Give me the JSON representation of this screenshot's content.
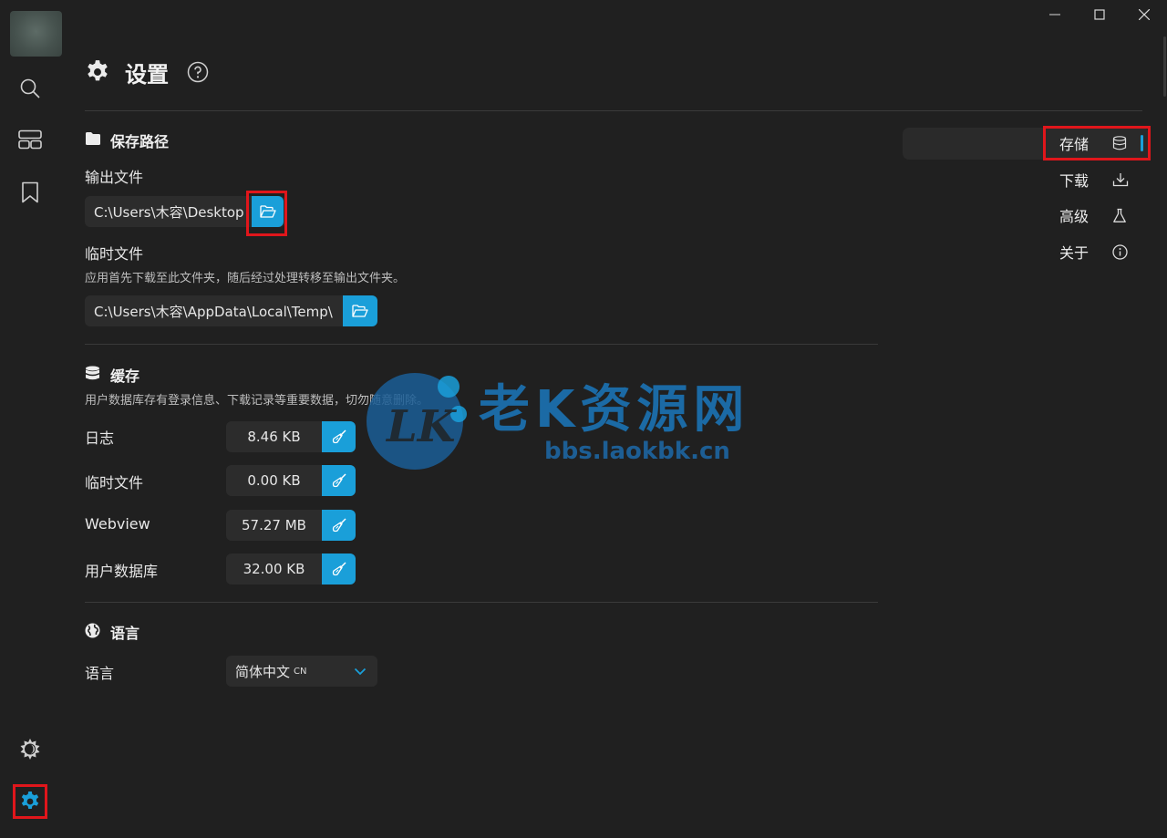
{
  "window": {
    "controls": [
      "minimize",
      "maximize",
      "close"
    ]
  },
  "sidebar": {
    "icons": [
      "search-icon",
      "layout-icon",
      "bookmark-icon",
      "theme-icon",
      "settings-icon"
    ],
    "active": "settings-icon",
    "accent": "#1a9fd9"
  },
  "header": {
    "title": "设置",
    "help_icon": "question-circle-icon"
  },
  "storage": {
    "title": "保存路径",
    "output_label": "输出文件",
    "output_path": "C:\\Users\\木容\\Desktop",
    "temp_label": "临时文件",
    "temp_desc": "应用首先下载至此文件夹，随后经过处理转移至输出文件夹。",
    "temp_path": "C:\\Users\\木容\\AppData\\Local\\Temp\\"
  },
  "cache": {
    "title": "缓存",
    "desc": "用户数据库存有登录信息、下载记录等重要数据，切勿随意删除。",
    "rows": [
      {
        "label": "日志",
        "size": "8.46 KB"
      },
      {
        "label": "临时文件",
        "size": "0.00 KB"
      },
      {
        "label": "Webview",
        "size": "57.27 MB"
      },
      {
        "label": "用户数据库",
        "size": "32.00 KB"
      }
    ]
  },
  "language": {
    "title": "语言",
    "label": "语言",
    "selected": "简体中文",
    "selected_code": "CN"
  },
  "nav": {
    "items": [
      {
        "label": "存储",
        "icon": "database-icon"
      },
      {
        "label": "下载",
        "icon": "download-icon"
      },
      {
        "label": "高级",
        "icon": "flask-icon"
      },
      {
        "label": "关于",
        "icon": "info-icon"
      }
    ],
    "active": "存储"
  },
  "watermark": {
    "logo_text": "LK",
    "text": "老K资源网",
    "url": "bbs.laokbk.cn"
  },
  "colors": {
    "accent": "#1a9fd9",
    "highlight": "#e0161b",
    "background": "#202020"
  }
}
